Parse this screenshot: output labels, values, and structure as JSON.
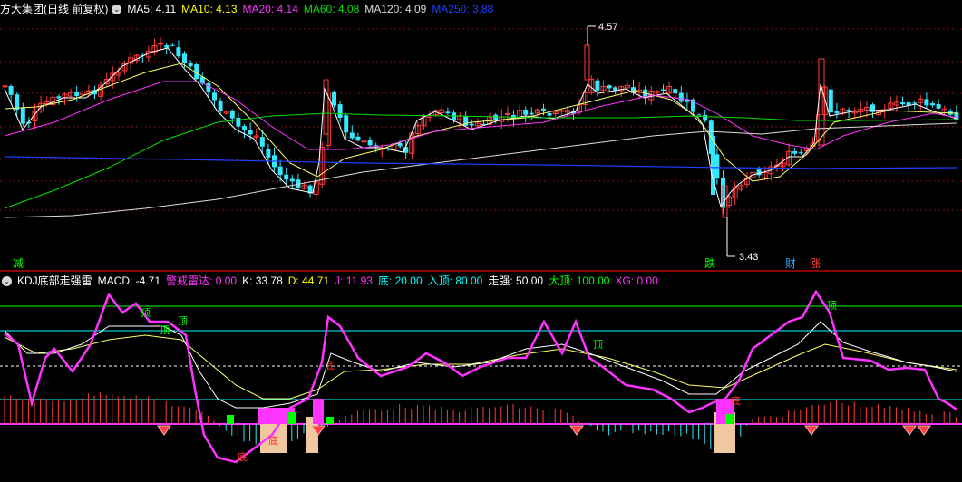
{
  "upper": {
    "stock_name": "方大集团(日线 前复权)",
    "ma": [
      {
        "label": "MA5: 4.11",
        "color": "#ffffff"
      },
      {
        "label": "MA10: 4.13",
        "color": "#ffff00"
      },
      {
        "label": "MA20: 4.14",
        "color": "#ff33ff"
      },
      {
        "label": "MA60: 4.08",
        "color": "#00e000"
      },
      {
        "label": "MA120: 4.09",
        "color": "#dddddd"
      },
      {
        "label": "MA250: 3.88",
        "color": "#1f3fff"
      }
    ],
    "high_label": "4.57",
    "low_label": "3.43",
    "marks": [
      {
        "text": "减",
        "color": "#00ff00"
      },
      {
        "text": "跌",
        "color": "#00ff00"
      },
      {
        "text": "财",
        "color": "#33aaff"
      },
      {
        "text": "涨",
        "color": "#ff4040"
      }
    ]
  },
  "lower": {
    "title": "KDJ底部走强雷",
    "items": [
      {
        "label": "MACD: -4.71",
        "color": "#ffffff"
      },
      {
        "label": "警戒雷达: 0.00",
        "color": "#ff33ff"
      },
      {
        "label": "K: 33.78",
        "color": "#ffffff"
      },
      {
        "label": "D: 44.71",
        "color": "#ffff00"
      },
      {
        "label": "J: 11.93",
        "color": "#ff33ff"
      },
      {
        "label": "底: 20.00",
        "color": "#00ffff"
      },
      {
        "label": "入顶: 80.00",
        "color": "#00ffff"
      },
      {
        "label": "走强: 50.00",
        "color": "#ffffff"
      },
      {
        "label": "大顶: 100.00",
        "color": "#00ff00"
      },
      {
        "label": "XG: 0.00",
        "color": "#ff33ff"
      }
    ],
    "top_label": "顶",
    "bottom_label": "底"
  },
  "colors": {
    "up": "#ff3b3b",
    "down": "#33e8ff",
    "grid": "#7a1010",
    "k": "#ffffff",
    "d": "#ffff66",
    "j": "#ff33ff",
    "level_line": "#00ffff",
    "top_line": "#00ff00"
  }
}
